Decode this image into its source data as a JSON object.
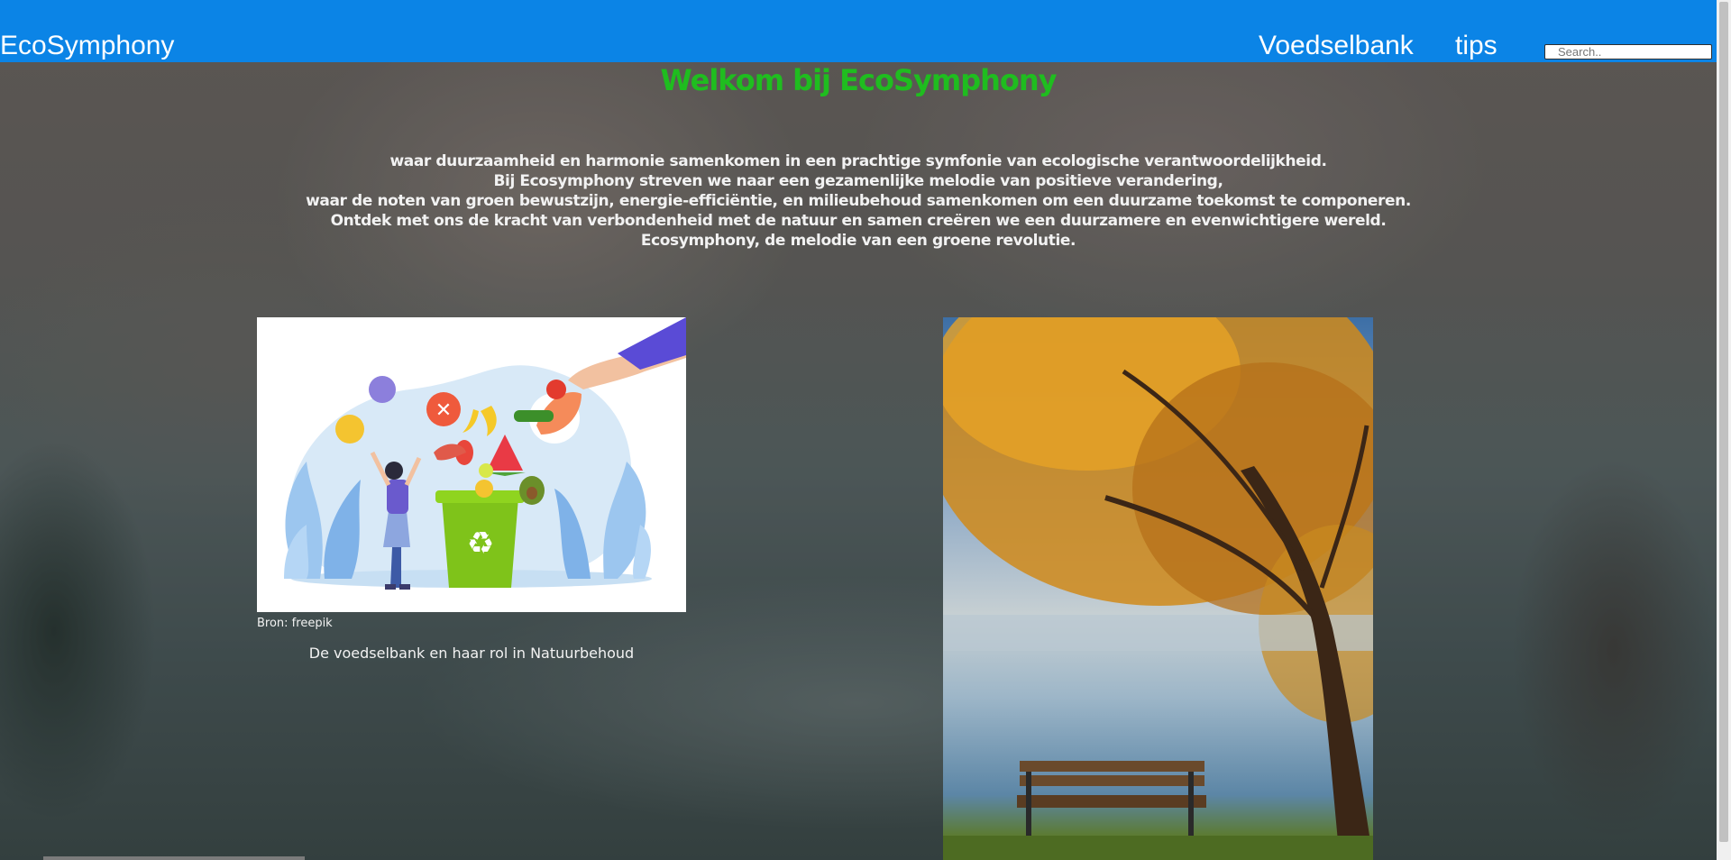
{
  "header": {
    "brand": "EcoSymphony",
    "nav": [
      {
        "label": "Voedselbank"
      },
      {
        "label": "tips"
      }
    ],
    "search": {
      "placeholder": "Search.."
    }
  },
  "main": {
    "title": "Welkom bij EcoSymphony",
    "intro_lines": [
      "waar duurzaamheid en harmonie samenkomen in een prachtige symfonie van ecologische verantwoordelijkheid.",
      "Bij Ecosymphony streven we naar een gezamenlijke melodie van positieve verandering,",
      "waar de noten van groen bewustzijn, energie-efficiëntie, en milieubehoud samenkomen om een duurzame toekomst te componeren.",
      "Ontdek met ons de kracht van verbondenheid met de natuur en samen creëren we een duurzamere en evenwichtigere wereld.",
      "Ecosymphony, de melodie van een groene revolutie."
    ],
    "cards": [
      {
        "image": "food-waste-recycling-illustration",
        "source": "Bron: freepik",
        "link": "De voedselbank en haar rol in Natuurbehoud"
      },
      {
        "image": "autumn-tree-bench-lake-photo"
      }
    ]
  },
  "colors": {
    "header_bg": "#0b84e6",
    "title": "#1fbd1f",
    "text": "#f2f2f2"
  }
}
